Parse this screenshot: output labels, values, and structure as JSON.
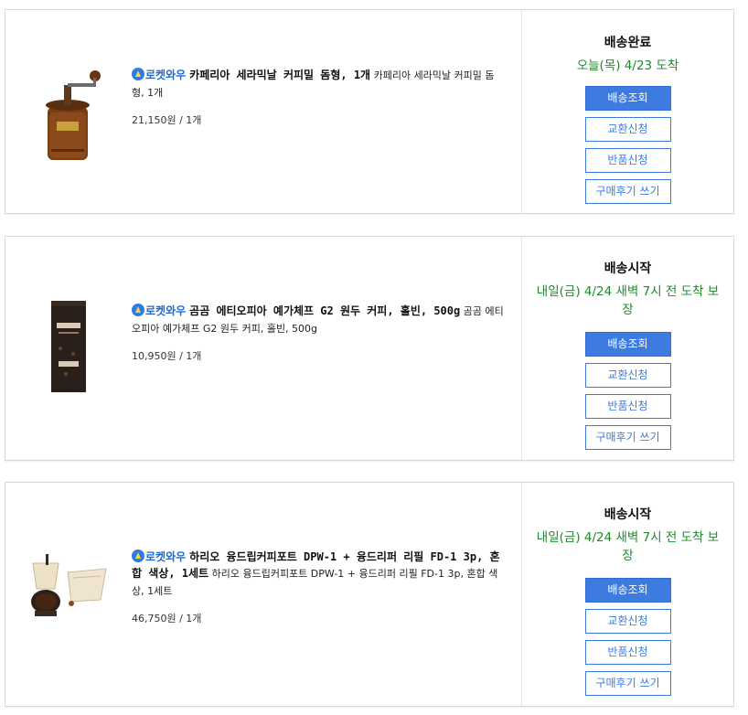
{
  "orders": [
    {
      "badge": "로켓와우",
      "name_bold": "카페리아 세라믹날 커피밀 돔형, 1개",
      "name_plain": " 카페리아 세라믹날 커피밀 돔형, 1개",
      "price": "21,150원 / 1개",
      "status": "배송완료",
      "eta": "오늘(목) 4/23 도착",
      "image": "coffee-grinder",
      "buttons": {
        "track": "배송조회",
        "exchange": "교환신청",
        "return": "반품신청",
        "review": "구매후기 쓰기"
      }
    },
    {
      "badge": "로켓와우",
      "name_bold": "곰곰 에티오피아 예가체프 G2 원두 커피, 홀빈, 500g",
      "name_plain": " 곰곰 에티오피아 예가체프 G2 원두 커피, 홀빈, 500g",
      "price": "10,950원 / 1개",
      "status": "배송시작",
      "eta": "내일(금) 4/24 새벽 7시 전 도착 보장",
      "image": "coffee-bag",
      "buttons": {
        "track": "배송조회",
        "exchange": "교환신청",
        "return": "반품신청",
        "review": "구매후기 쓰기"
      }
    },
    {
      "badge": "로켓와우",
      "name_bold": "하리오 융드립커피포트 DPW-1 + 융드리퍼 리필 FD-1 3p, 혼합 색상, 1세트",
      "name_plain": " 하리오 융드립커피포트 DPW-1 + 융드리퍼 리필 FD-1 3p, 혼합 색상, 1세트",
      "price": "46,750원 / 1개",
      "status": "배송시작",
      "eta": "내일(금) 4/24 새벽 7시 전 도착 보장",
      "image": "drip-pot-set",
      "buttons": {
        "track": "배송조회",
        "exchange": "교환신청",
        "return": "반품신청",
        "review": "구매후기 쓰기"
      }
    }
  ]
}
